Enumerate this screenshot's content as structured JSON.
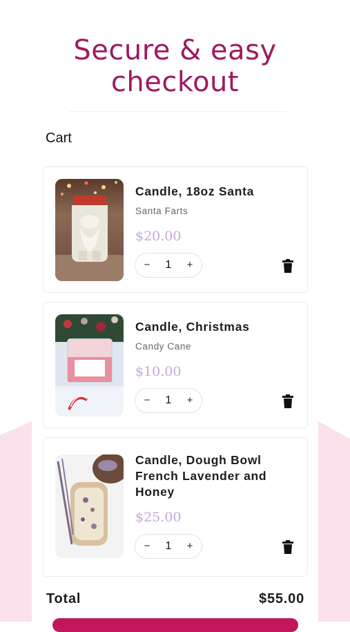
{
  "header": {
    "title_line1": "Secure & easy",
    "title_line2": "checkout"
  },
  "cart": {
    "label": "Cart",
    "items": [
      {
        "title": "Candle, 18oz Santa",
        "variant": "Santa Farts",
        "price": "$20.00",
        "quantity": "1",
        "image": "santa-candle-jar"
      },
      {
        "title": "Candle, Christmas",
        "variant": "Candy Cane",
        "price": "$10.00",
        "quantity": "1",
        "image": "christmas-candle-jar"
      },
      {
        "title": "Candle, Dough Bowl French Lavender and Honey",
        "variant": "",
        "price": "$25.00",
        "quantity": "1",
        "image": "dough-bowl-candle"
      }
    ]
  },
  "controls": {
    "minus": "−",
    "plus": "+"
  },
  "summary": {
    "total_label": "Total",
    "total_value": "$55.00"
  },
  "colors": {
    "brand": "#a0195f",
    "price": "#c6a8d8",
    "background_accent": "#fbe1ec"
  }
}
